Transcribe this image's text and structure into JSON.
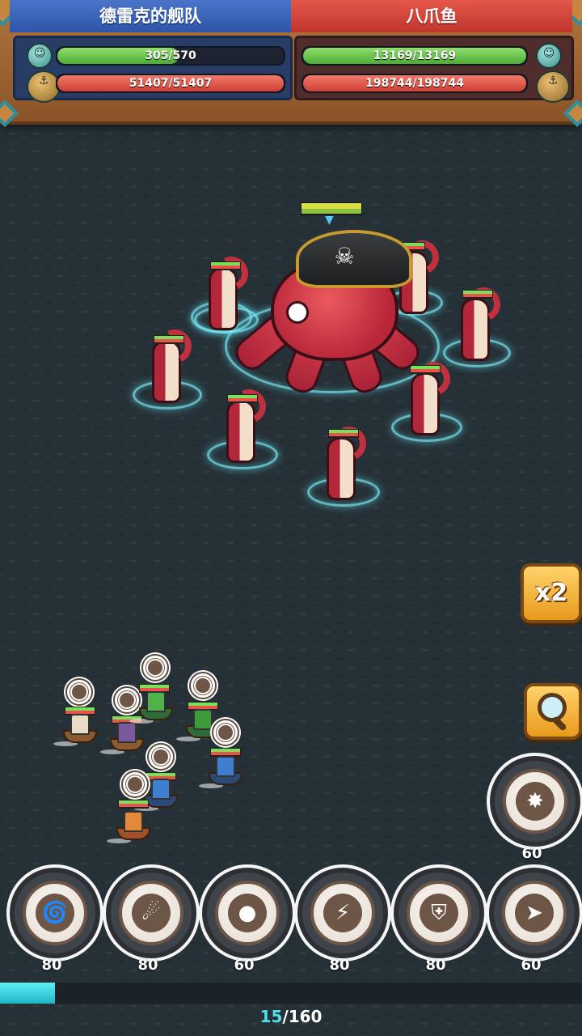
{
  "header": {
    "left_team": "德雷克的舰队",
    "right_team": "八爪鱼",
    "left_crew": {
      "text": "305/570",
      "fraction": 0.535
    },
    "left_ship": {
      "text": "51407/51407",
      "fraction": 1.0
    },
    "right_crew": {
      "text": "13169/13169",
      "fraction": 1.0
    },
    "right_ship": {
      "text": "198744/198744",
      "fraction": 1.0
    },
    "icons": {
      "crew": "pirate-crew-icon",
      "ship": "ship-helm-icon"
    }
  },
  "controls": {
    "speed_label": "x2",
    "speed_icon": "speed-x2-icon",
    "zoom_icon": "magnifier-icon"
  },
  "side_skill": {
    "icon": "spiked-burst-icon",
    "cost": "60"
  },
  "skills": [
    {
      "icon": "tornado-icon",
      "cost": "80"
    },
    {
      "icon": "comet-icon",
      "cost": "80"
    },
    {
      "icon": "cannonball-icon",
      "cost": "60"
    },
    {
      "icon": "lightning-orb-icon",
      "cost": "80"
    },
    {
      "icon": "winged-shield-icon",
      "cost": "80"
    },
    {
      "icon": "shark-icon",
      "cost": "60"
    }
  ],
  "progress": {
    "current": "15",
    "separator": "/",
    "total": "160",
    "fraction": 0.094
  },
  "colors": {
    "team_blue": "#3a64b8",
    "team_red": "#d4463c",
    "accent_cyan": "#4fe0ea"
  }
}
